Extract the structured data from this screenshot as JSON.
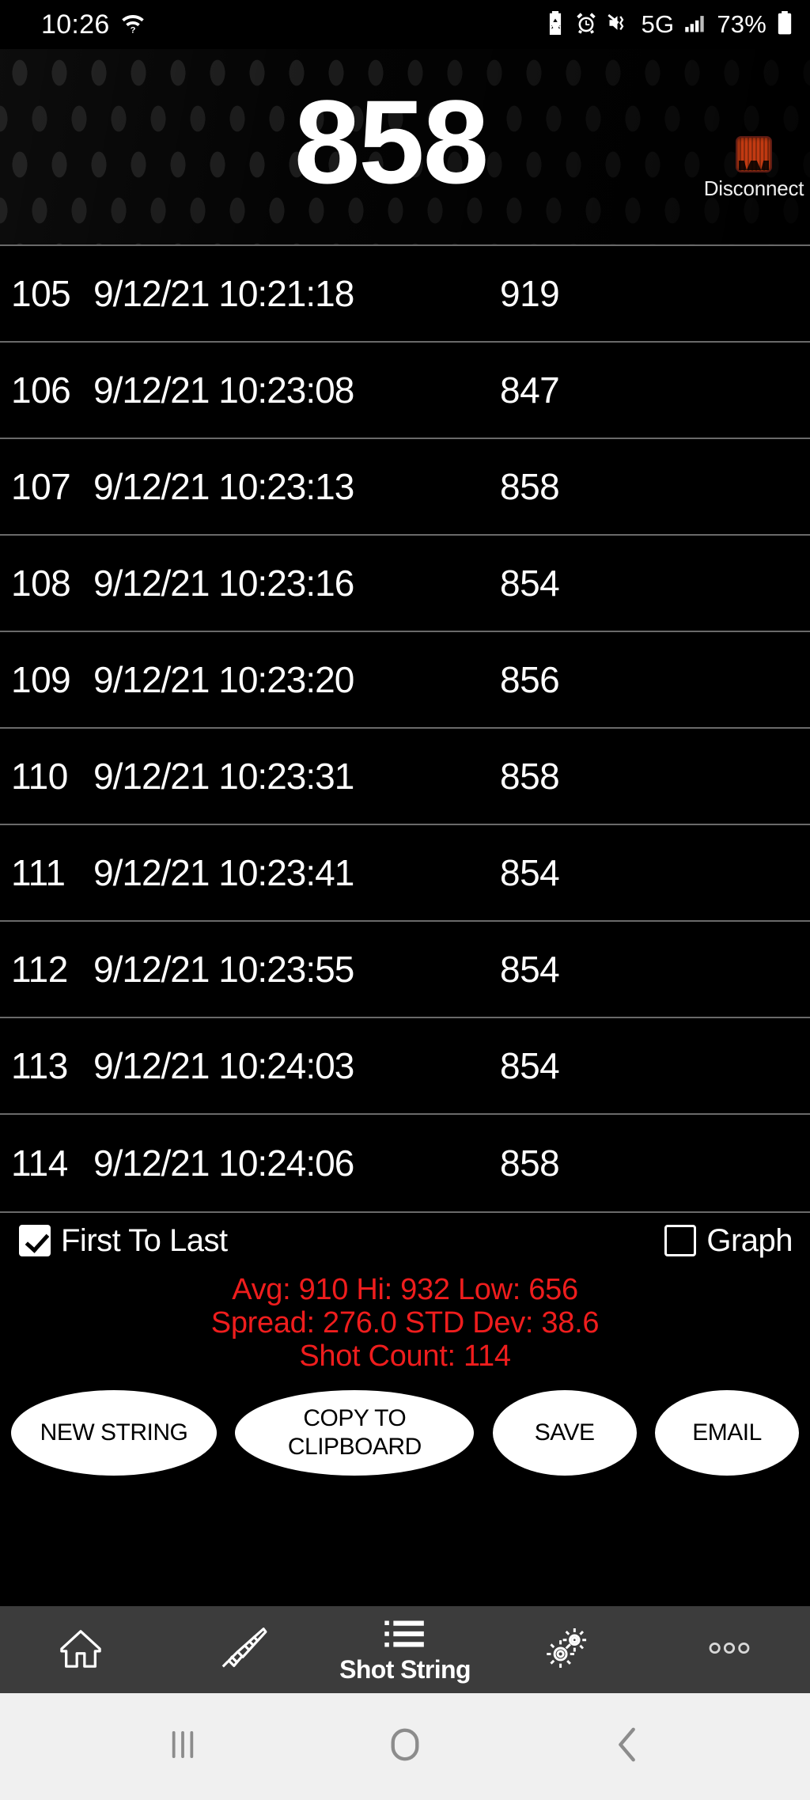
{
  "status_bar": {
    "time": "10:26",
    "wifi_icon": "wifi-question-icon",
    "battery_saver_icon": "battery-saver-icon",
    "alarm_icon": "alarm-clock-icon",
    "mute_icon": "mute-vibrate-icon",
    "network_label": "5G",
    "signal_icon": "signal-bars-icon",
    "battery_percent": "73%",
    "battery_icon": "battery-icon"
  },
  "header": {
    "current_value": "858",
    "disconnect_label": "Disconnect",
    "disconnect_icon": "device-disconnect-icon"
  },
  "shot_table": {
    "rows": [
      {
        "index": "105",
        "timestamp": "9/12/21 10:21:18",
        "velocity": "919"
      },
      {
        "index": "106",
        "timestamp": "9/12/21 10:23:08",
        "velocity": "847"
      },
      {
        "index": "107",
        "timestamp": "9/12/21 10:23:13",
        "velocity": "858"
      },
      {
        "index": "108",
        "timestamp": "9/12/21 10:23:16",
        "velocity": "854"
      },
      {
        "index": "109",
        "timestamp": "9/12/21 10:23:20",
        "velocity": "856"
      },
      {
        "index": "110",
        "timestamp": "9/12/21 10:23:31",
        "velocity": "858"
      },
      {
        "index": "111",
        "timestamp": "9/12/21 10:23:41",
        "velocity": "854"
      },
      {
        "index": "112",
        "timestamp": "9/12/21 10:23:55",
        "velocity": "854"
      },
      {
        "index": "113",
        "timestamp": "9/12/21 10:24:03",
        "velocity": "854"
      },
      {
        "index": "114",
        "timestamp": "9/12/21 10:24:06",
        "velocity": "858"
      }
    ]
  },
  "options": {
    "first_to_last_label": "First To Last",
    "first_to_last_checked": true,
    "graph_label": "Graph",
    "graph_checked": false
  },
  "stats": {
    "line1": "Avg:  910  Hi:  932  Low:  656",
    "line2": "Spread:  276.0  STD Dev:  38.6",
    "line3": "Shot Count:  114",
    "avg": "910",
    "hi": "932",
    "low": "656",
    "spread": "276.0",
    "std_dev": "38.6",
    "shot_count": "114",
    "color": "#ef1d1d"
  },
  "actions": {
    "new_string": "NEW STRING",
    "copy_to_clipboard": "COPY TO\nCLIPBOARD",
    "copy_line1": "COPY TO",
    "copy_line2": "CLIPBOARD",
    "save": "SAVE",
    "email": "EMAIL"
  },
  "bottom_nav": {
    "items": [
      {
        "icon": "home-icon",
        "label": ""
      },
      {
        "icon": "rifle-icon",
        "label": ""
      },
      {
        "icon": "list-icon",
        "label": "Shot String"
      },
      {
        "icon": "gears-icon",
        "label": ""
      },
      {
        "icon": "overflow-dots-icon",
        "label": ""
      }
    ]
  },
  "system_nav": {
    "recents_icon": "recents-icon",
    "home_icon": "android-home-icon",
    "back_icon": "android-back-icon"
  }
}
